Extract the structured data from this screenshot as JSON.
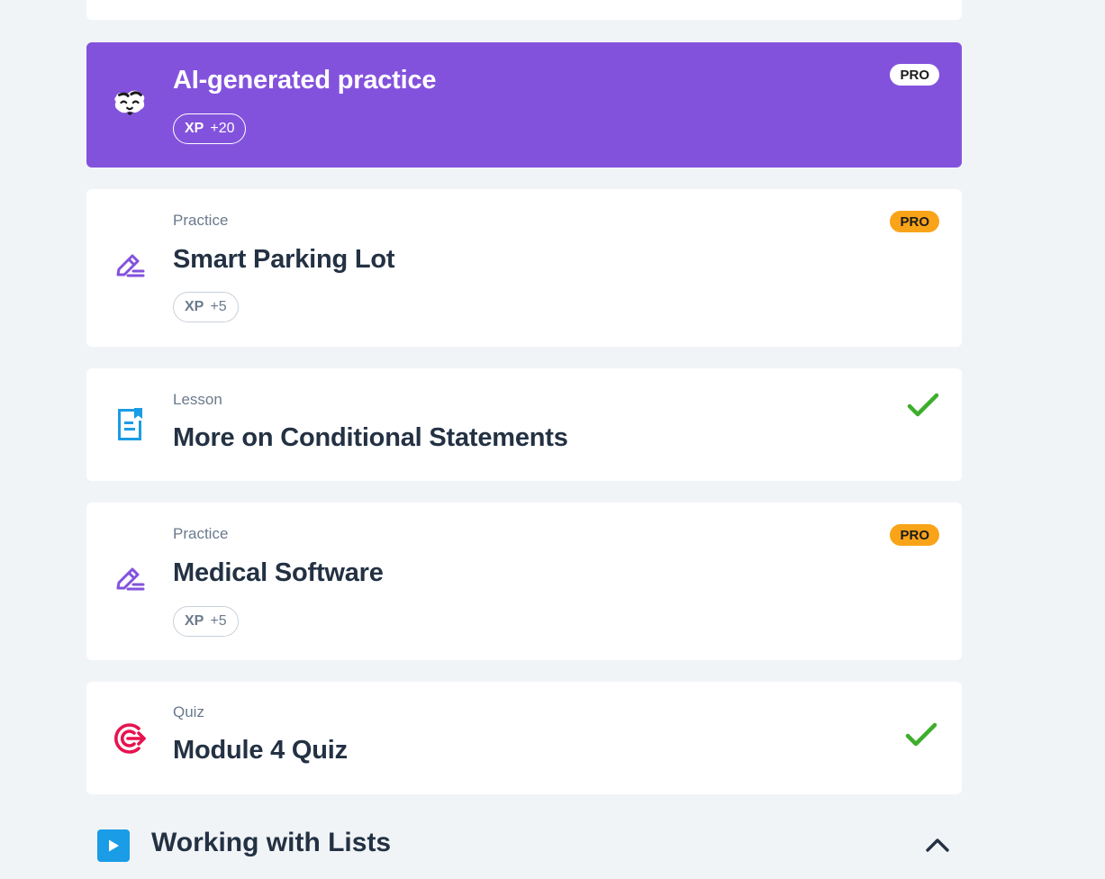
{
  "items": [
    {
      "type": "",
      "title": "AI-generated practice",
      "xp_label": "XP",
      "xp_value": "+20",
      "badge": "PRO",
      "icon": "ai-mascot-icon",
      "completed": false
    },
    {
      "type": "Practice",
      "title": "Smart Parking Lot",
      "xp_label": "XP",
      "xp_value": "+5",
      "badge": "PRO",
      "icon": "pencil-icon",
      "completed": false
    },
    {
      "type": "Lesson",
      "title": "More on Conditional Statements",
      "icon": "lesson-document-icon",
      "completed": true
    },
    {
      "type": "Practice",
      "title": "Medical Software",
      "xp_label": "XP",
      "xp_value": "+5",
      "badge": "PRO",
      "icon": "pencil-icon",
      "completed": false
    },
    {
      "type": "Quiz",
      "title": "Module 4 Quiz",
      "icon": "target-icon",
      "completed": true
    }
  ],
  "next_section": {
    "title": "Working with Lists",
    "icon": "play-icon",
    "expanded": true
  },
  "colors": {
    "ai_card": "#8352dd",
    "pro_badge": "#f9a418",
    "check": "#3dae2b",
    "practice_icon": "#8352dd",
    "lesson_icon": "#1a9ce6",
    "quiz_icon": "#e8124f",
    "section_icon": "#1a9ce6"
  }
}
